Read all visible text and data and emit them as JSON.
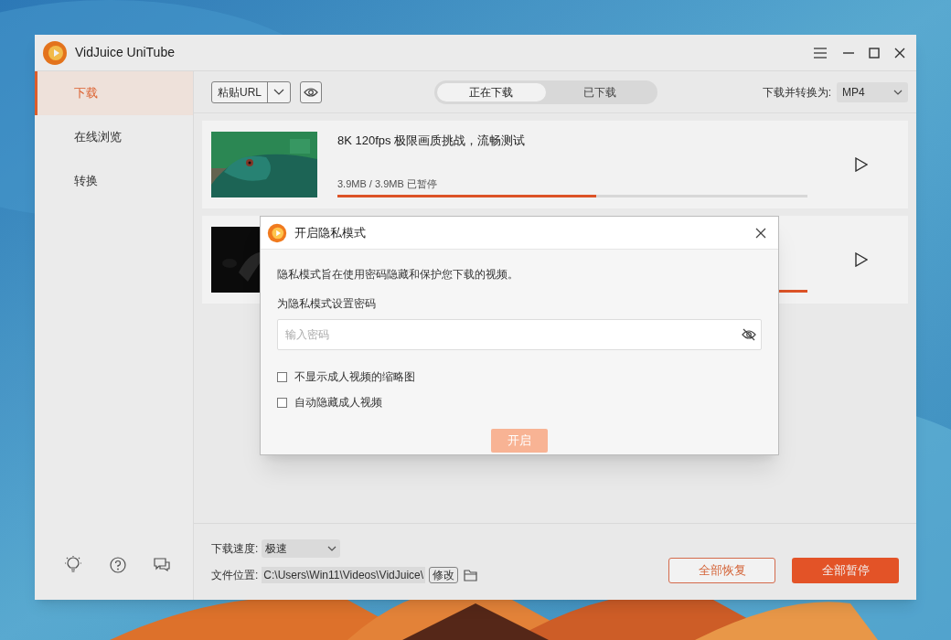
{
  "window": {
    "title": "VidJuice UniTube"
  },
  "sidebar": {
    "items": [
      {
        "label": "下载",
        "selected": true
      },
      {
        "label": "在线浏览",
        "selected": false
      },
      {
        "label": "转换",
        "selected": false
      }
    ]
  },
  "toolbar": {
    "paste_button": "粘贴URL",
    "tabs": [
      {
        "label": "正在下载",
        "selected": true
      },
      {
        "label": "已下载",
        "selected": false
      }
    ],
    "convert_label": "下载并转换为:",
    "format": "MP4"
  },
  "downloads": [
    {
      "title": "8K 120fps 极限画质挑战，流畅测试",
      "progress_text": "3.9MB / 3.9MB 已暂停",
      "level": 0.55
    },
    {
      "level": 1
    }
  ],
  "bottom": {
    "speed_label": "下载速度:",
    "speed": "极速",
    "location_label": "文件位置:",
    "path": "C:\\Users\\Win11\\Videos\\VidJuice\\",
    "change_button": "修改",
    "resume_all": "全部恢复",
    "pause_all": "全部暂停"
  },
  "dialog": {
    "title": "开启隐私模式",
    "description": "隐私模式旨在使用密码隐藏和保护您下载的视频。",
    "password_label": "为隐私模式设置密码",
    "password_placeholder": "输入密码",
    "options": [
      {
        "label": "不显示成人视频的缩略图",
        "checked": false
      },
      {
        "label": "自动隐藏成人视频",
        "checked": false
      }
    ],
    "confirm_button": "开启",
    "confirm_disabled": true
  }
}
